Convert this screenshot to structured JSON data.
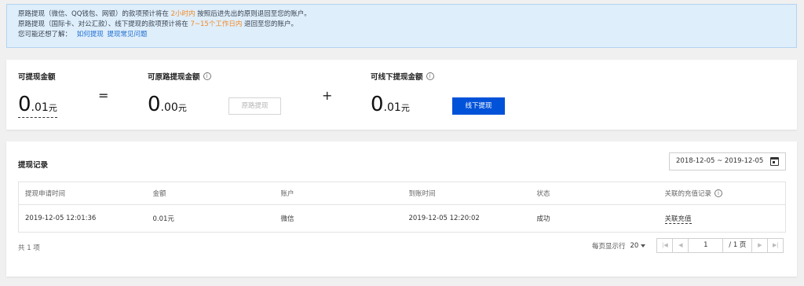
{
  "notice": {
    "line1_pre": "原路提现（微信、QQ钱包、网银）的款项预计将在",
    "line1_warn": "2小时内",
    "line1_post": "按照后进先出的原则退回至您的账户。",
    "line2_pre": "原路提现（国际卡、对公汇款）、线下提现的款项预计将在",
    "line2_warn": "7~15个工作日内",
    "line2_post": "退回至您的账户。",
    "line3_label": "您可能还想了解：",
    "link_how": "如何提现",
    "link_faq": "提现常见问题"
  },
  "balance": {
    "withdrawable": {
      "title": "可提现金额",
      "int": "0",
      "dec": ".01",
      "unit": "元"
    },
    "equals": "=",
    "original": {
      "title": "可原路提现金额",
      "int": "0",
      "dec": ".00",
      "unit": "元",
      "button": "原路提现"
    },
    "plus": "+",
    "offline": {
      "title": "可线下提现金额",
      "int": "0",
      "dec": ".01",
      "unit": "元",
      "button": "线下提现"
    }
  },
  "records": {
    "title": "提现记录",
    "date_range": "2018-12-05 ~ 2019-12-05",
    "columns": [
      "提现申请时间",
      "金额",
      "账户",
      "到账时间",
      "状态",
      "关联的充值记录"
    ],
    "rows": [
      {
        "apply_time": "2019-12-05 12:01:36",
        "amount": "0.01元",
        "account": "微信",
        "arrival_time": "2019-12-05 12:20:02",
        "status": "成功",
        "link": "关联充值"
      }
    ],
    "total": "共 1 项",
    "page_size_label": "每页显示行",
    "page_size": "20",
    "current_page": "1",
    "page_total": "/ 1 页"
  },
  "colors": {
    "primary": "#0052d9",
    "warning": "#f08a24",
    "success": "#2ca84c",
    "link": "#1f6fd1"
  },
  "icons": [
    "info-icon",
    "calendar-icon",
    "chevron-down-icon",
    "first-page-icon",
    "prev-page-icon",
    "next-page-icon",
    "last-page-icon"
  ]
}
